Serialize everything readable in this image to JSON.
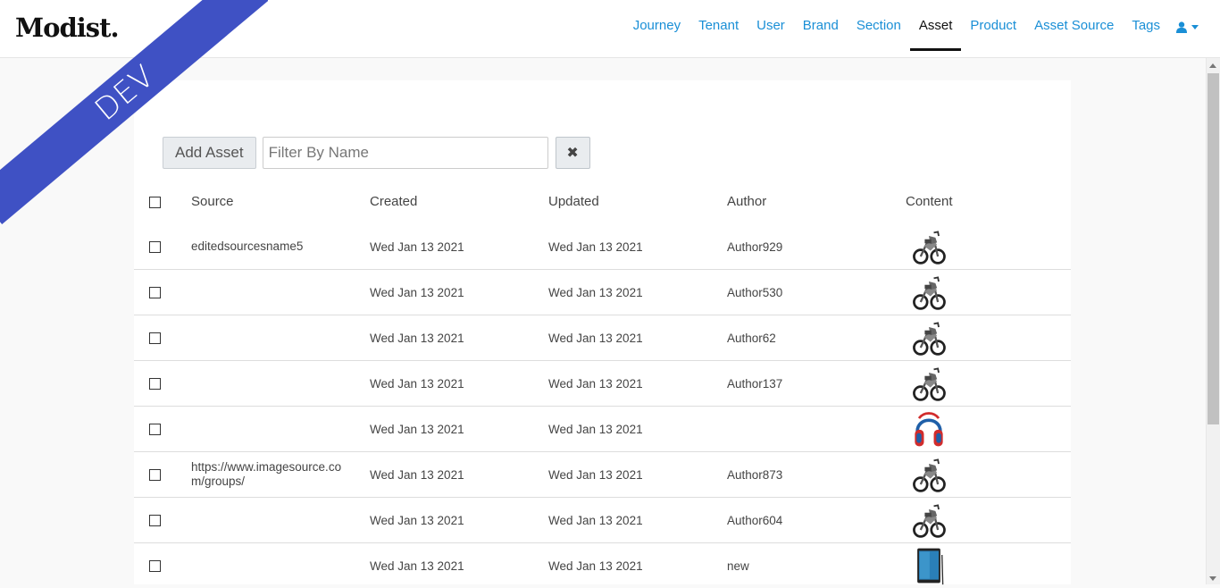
{
  "app": {
    "logo": "Modist.",
    "env_badge": "DEV"
  },
  "nav": {
    "items": [
      {
        "label": "Journey",
        "active": false
      },
      {
        "label": "Tenant",
        "active": false
      },
      {
        "label": "User",
        "active": false
      },
      {
        "label": "Brand",
        "active": false
      },
      {
        "label": "Section",
        "active": false
      },
      {
        "label": "Asset",
        "active": true
      },
      {
        "label": "Product",
        "active": false
      },
      {
        "label": "Asset Source",
        "active": false
      },
      {
        "label": "Tags",
        "active": false
      }
    ],
    "user_icon": "user-icon"
  },
  "toolbar": {
    "add_label": "Add Asset",
    "filter_placeholder": "Filter By Name",
    "filter_value": "",
    "clear_icon": "times-icon"
  },
  "table": {
    "columns": [
      "Source",
      "Created",
      "Updated",
      "Author",
      "Content"
    ],
    "rows": [
      {
        "source": "editedsourcesname5",
        "created": "Wed Jan 13 2021",
        "updated": "Wed Jan 13 2021",
        "author": "Author929",
        "content": "motorcycle-image"
      },
      {
        "source": "",
        "created": "Wed Jan 13 2021",
        "updated": "Wed Jan 13 2021",
        "author": "Author530",
        "content": "motorcycle-image"
      },
      {
        "source": "",
        "created": "Wed Jan 13 2021",
        "updated": "Wed Jan 13 2021",
        "author": "Author62",
        "content": "motorcycle-image"
      },
      {
        "source": "",
        "created": "Wed Jan 13 2021",
        "updated": "Wed Jan 13 2021",
        "author": "Author137",
        "content": "motorcycle-image"
      },
      {
        "source": "",
        "created": "Wed Jan 13 2021",
        "updated": "Wed Jan 13 2021",
        "author": "",
        "content": "headphones-image"
      },
      {
        "source": "https://www.imagesource.com/groups/",
        "created": "Wed Jan 13 2021",
        "updated": "Wed Jan 13 2021",
        "author": "Author873",
        "content": "motorcycle-image"
      },
      {
        "source": "",
        "created": "Wed Jan 13 2021",
        "updated": "Wed Jan 13 2021",
        "author": "Author604",
        "content": "motorcycle-image"
      },
      {
        "source": "",
        "created": "Wed Jan 13 2021",
        "updated": "Wed Jan 13 2021",
        "author": "new",
        "content": "tablet-image"
      }
    ]
  },
  "colors": {
    "link": "#1a8fd6",
    "ribbon": "#3f51c4",
    "active_nav": "#111111"
  }
}
